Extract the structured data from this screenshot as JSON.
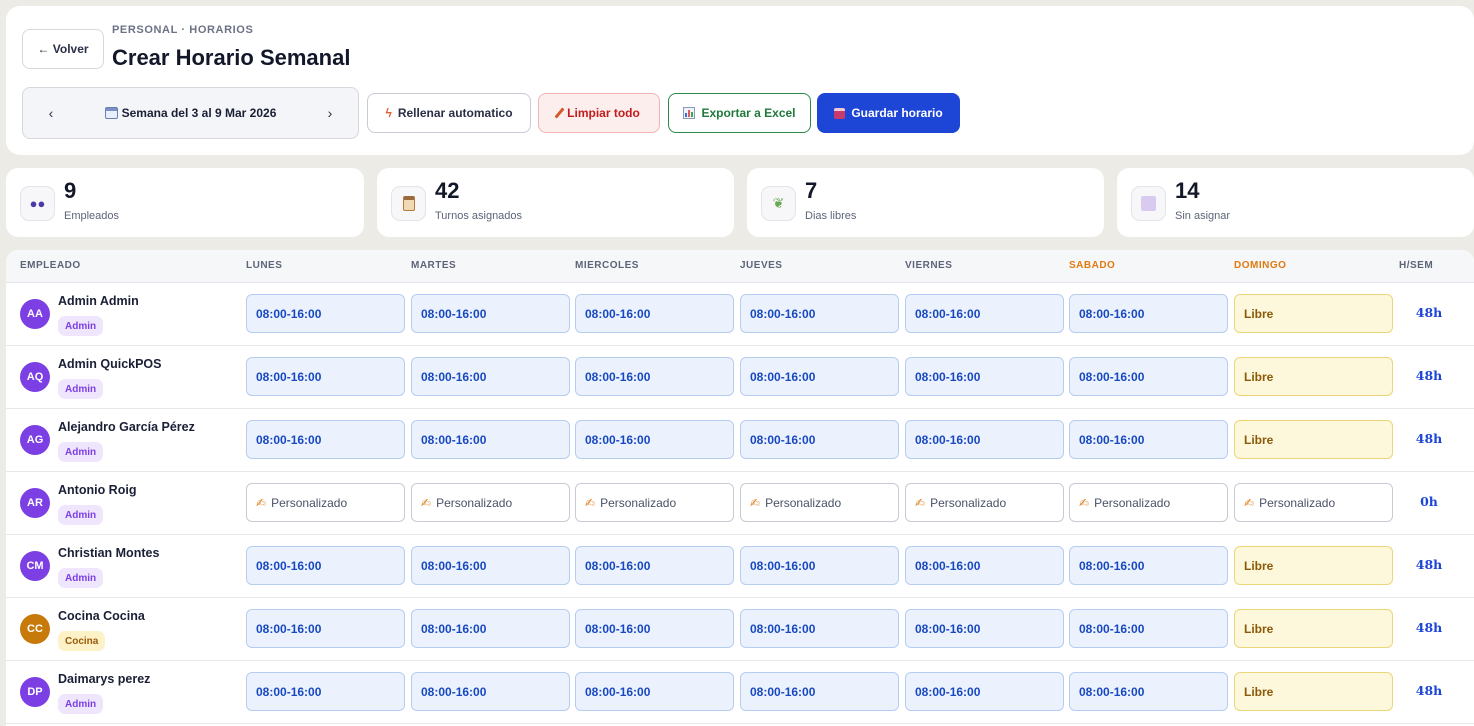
{
  "header": {
    "back_label": "← Volver",
    "breadcrumb": "PERSONAL · HORARIOS",
    "title": "Crear Horario Semanal"
  },
  "week_nav": {
    "prev": "‹",
    "next": "›",
    "label": "Semana del 3 al 9 Mar 2026"
  },
  "toolbar": {
    "auto_fill": "Rellenar automatico",
    "clear_all": "Limpiar todo",
    "export": "Exportar a Excel",
    "save": "Guardar horario"
  },
  "stats": [
    {
      "value": "9",
      "label": "Empleados",
      "icon": "people-icon"
    },
    {
      "value": "42",
      "label": "Turnos asignados",
      "icon": "clipboard-icon"
    },
    {
      "value": "7",
      "label": "Dias libres",
      "icon": "leaf-icon"
    },
    {
      "value": "14",
      "label": "Sin asignar",
      "icon": "square-icon"
    }
  ],
  "table": {
    "columns": [
      "EMPLEADO",
      "LUNES",
      "MARTES",
      "MIERCOLES",
      "JUEVES",
      "VIERNES",
      "SABADO",
      "DOMINGO",
      "H/SEM"
    ],
    "rows": [
      {
        "initials": "AA",
        "name": "Admin Admin",
        "role": "Admin",
        "avatar_color": "#7b3fe4",
        "days": [
          "08:00-16:00",
          "08:00-16:00",
          "08:00-16:00",
          "08:00-16:00",
          "08:00-16:00",
          "08:00-16:00",
          "Libre"
        ],
        "kinds": [
          "shift",
          "shift",
          "shift",
          "shift",
          "shift",
          "shift",
          "off"
        ],
        "hours": "48h"
      },
      {
        "initials": "AQ",
        "name": "Admin QuickPOS",
        "role": "Admin",
        "avatar_color": "#7b3fe4",
        "days": [
          "08:00-16:00",
          "08:00-16:00",
          "08:00-16:00",
          "08:00-16:00",
          "08:00-16:00",
          "08:00-16:00",
          "Libre"
        ],
        "kinds": [
          "shift",
          "shift",
          "shift",
          "shift",
          "shift",
          "shift",
          "off"
        ],
        "hours": "48h"
      },
      {
        "initials": "AG",
        "name": "Alejandro García Pérez",
        "role": "Admin",
        "avatar_color": "#7b3fe4",
        "days": [
          "08:00-16:00",
          "08:00-16:00",
          "08:00-16:00",
          "08:00-16:00",
          "08:00-16:00",
          "08:00-16:00",
          "Libre"
        ],
        "kinds": [
          "shift",
          "shift",
          "shift",
          "shift",
          "shift",
          "shift",
          "off"
        ],
        "hours": "48h"
      },
      {
        "initials": "AR",
        "name": "Antonio Roig",
        "role": "Admin",
        "avatar_color": "#7b3fe4",
        "days": [
          "Personalizado",
          "Personalizado",
          "Personalizado",
          "Personalizado",
          "Personalizado",
          "Personalizado",
          "Personalizado"
        ],
        "kinds": [
          "custom",
          "custom",
          "custom",
          "custom",
          "custom",
          "custom",
          "custom"
        ],
        "hours": "0h"
      },
      {
        "initials": "CM",
        "name": "Christian Montes",
        "role": "Admin",
        "avatar_color": "#7b3fe4",
        "days": [
          "08:00-16:00",
          "08:00-16:00",
          "08:00-16:00",
          "08:00-16:00",
          "08:00-16:00",
          "08:00-16:00",
          "Libre"
        ],
        "kinds": [
          "shift",
          "shift",
          "shift",
          "shift",
          "shift",
          "shift",
          "off"
        ],
        "hours": "48h"
      },
      {
        "initials": "CC",
        "name": "Cocina Cocina",
        "role": "Cocina",
        "avatar_color": "#c77a0a",
        "days": [
          "08:00-16:00",
          "08:00-16:00",
          "08:00-16:00",
          "08:00-16:00",
          "08:00-16:00",
          "08:00-16:00",
          "Libre"
        ],
        "kinds": [
          "shift",
          "shift",
          "shift",
          "shift",
          "shift",
          "shift",
          "off"
        ],
        "hours": "48h"
      },
      {
        "initials": "DP",
        "name": "Daimarys perez",
        "role": "Admin",
        "avatar_color": "#7b3fe4",
        "days": [
          "08:00-16:00",
          "08:00-16:00",
          "08:00-16:00",
          "08:00-16:00",
          "08:00-16:00",
          "08:00-16:00",
          "Libre"
        ],
        "kinds": [
          "shift",
          "shift",
          "shift",
          "shift",
          "shift",
          "shift",
          "off"
        ],
        "hours": "48h"
      }
    ]
  },
  "colors": {
    "primary": "#1e46d6",
    "weekend_header": "#e07a10",
    "admin_badge_bg": "#efe6fd",
    "admin_badge_text": "#7b3fe4",
    "cocina_badge_bg": "#fdf1c8",
    "cocina_badge_text": "#9a5a06"
  }
}
